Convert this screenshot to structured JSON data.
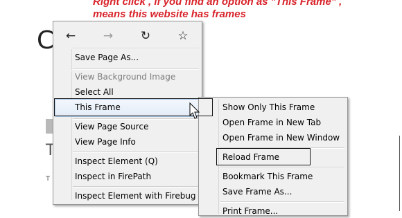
{
  "annotation": {
    "line1": "Right click , if you find an option as \"This Frame\" ,",
    "line2": "means this website has frames"
  },
  "page_background": {
    "heading_fragment": "C",
    "subheading_fragment": "T",
    "small_fragment": "T"
  },
  "nav": {
    "back_icon": "back-arrow-icon",
    "forward_icon": "forward-arrow-icon",
    "reload_icon": "reload-icon",
    "bookmark_icon": "star-icon",
    "back_glyph": "←",
    "forward_glyph": "→",
    "reload_glyph": "↻",
    "bookmark_glyph": "☆"
  },
  "context_menu": {
    "items": [
      {
        "label": "Save Page As...",
        "enabled": true
      },
      {
        "label": "View Background Image",
        "enabled": false
      },
      {
        "label": "Select All",
        "enabled": true
      },
      {
        "label": "This Frame",
        "enabled": true,
        "submenu": true,
        "hovered": true
      },
      {
        "label": "View Page Source",
        "enabled": true
      },
      {
        "label": "View Page Info",
        "enabled": true
      },
      {
        "label": "Inspect Element (Q)",
        "enabled": true
      },
      {
        "label": "Inspect in FirePath",
        "enabled": true
      },
      {
        "label": "Inspect Element with Firebug",
        "enabled": true
      }
    ]
  },
  "frame_submenu": {
    "items": [
      {
        "label": "Show Only This Frame"
      },
      {
        "label": "Open Frame in New Tab"
      },
      {
        "label": "Open Frame in New Window"
      },
      {
        "label": "Reload Frame"
      },
      {
        "label": "Bookmark This Frame"
      },
      {
        "label": "Save Frame As..."
      },
      {
        "label": "Print Frame..."
      }
    ]
  },
  "colors": {
    "annotation": "#d8232a",
    "menu_background": "#f0f0f0",
    "hover_highlight": "#dde8f6"
  }
}
